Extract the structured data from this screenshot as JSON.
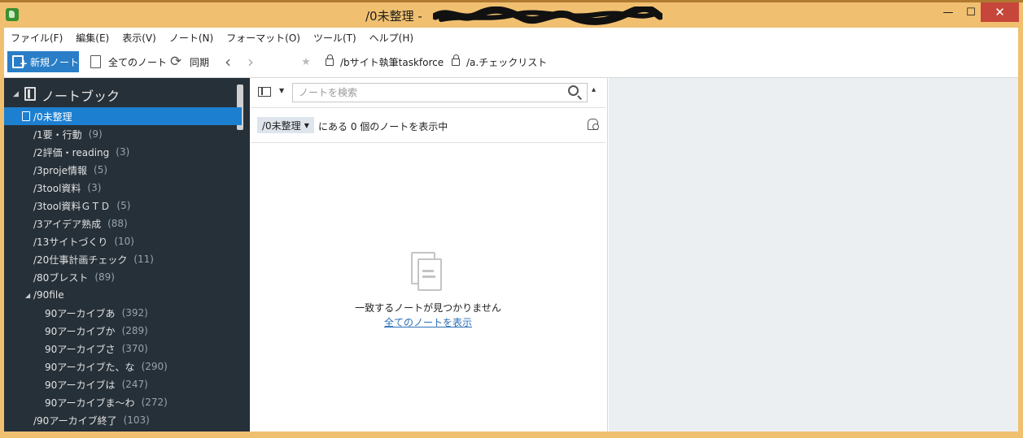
{
  "window": {
    "title": "/0未整理 -",
    "minimize_glyph": "—",
    "maximize_glyph": "☐",
    "close_glyph": "✕"
  },
  "menu": {
    "items": [
      {
        "label": "ファイル(F)"
      },
      {
        "label": "編集(E)"
      },
      {
        "label": "表示(V)"
      },
      {
        "label": "ノート(N)"
      },
      {
        "label": "フォーマット(O)"
      },
      {
        "label": "ツール(T)"
      },
      {
        "label": "ヘルプ(H)"
      }
    ]
  },
  "toolbar": {
    "new_note_label": "新規ノート",
    "all_notes_label": "全てのノート",
    "sync_label": "同期",
    "back_glyph": "‹",
    "forward_glyph": "›",
    "star_glyph": "★",
    "shortcuts": [
      {
        "label": "/bサイト執筆taskforce"
      },
      {
        "label": "/a.チェックリスト"
      }
    ]
  },
  "sidebar": {
    "header": "ノートブック",
    "collapse_glyph": "◢",
    "notebooks": [
      {
        "name": "/0未整理",
        "count": "",
        "selected": true
      },
      {
        "name": "/1要・行動",
        "count": "(9)"
      },
      {
        "name": "/2評価・reading",
        "count": "(3)"
      },
      {
        "name": "/3proje情報",
        "count": "(5)"
      },
      {
        "name": "/3tool資料",
        "count": "(3)"
      },
      {
        "name": "/3tool資料ＧＴＤ",
        "count": "(5)"
      },
      {
        "name": "/3アイデア熟成",
        "count": "(88)"
      },
      {
        "name": "/13サイトづくり",
        "count": "(10)"
      },
      {
        "name": "/20仕事計画チェック",
        "count": "(11)"
      },
      {
        "name": "/80ブレスト",
        "count": "(89)"
      },
      {
        "name": "/90file",
        "count": "",
        "stack": true
      },
      {
        "name": "90アーカイブあ",
        "count": "(392)",
        "child": true
      },
      {
        "name": "90アーカイブか",
        "count": "(289)",
        "child": true
      },
      {
        "name": "90アーカイブさ",
        "count": "(370)",
        "child": true
      },
      {
        "name": "90アーカイブた、な",
        "count": "(290)",
        "child": true
      },
      {
        "name": "90アーカイブは",
        "count": "(247)",
        "child": true
      },
      {
        "name": "90アーカイブま～わ",
        "count": "(272)",
        "child": true
      },
      {
        "name": "/90アーカイブ終了",
        "count": "(103)"
      }
    ]
  },
  "notelist": {
    "search_placeholder": "ノートを検索",
    "notebook_filter": "/0未整理",
    "filter_text": "にある 0 個のノートを表示中",
    "empty_message": "一致するノートが見つかりません",
    "show_all_link": "全てのノートを表示",
    "collapse_glyph": "▴"
  },
  "colors": {
    "title_bar": "#f0c070",
    "sidebar_bg": "#263038",
    "selection": "#1d7fd0",
    "new_note_button": "#2a7ec7",
    "link": "#2b6fb5",
    "editor_bg": "#eceff1"
  }
}
